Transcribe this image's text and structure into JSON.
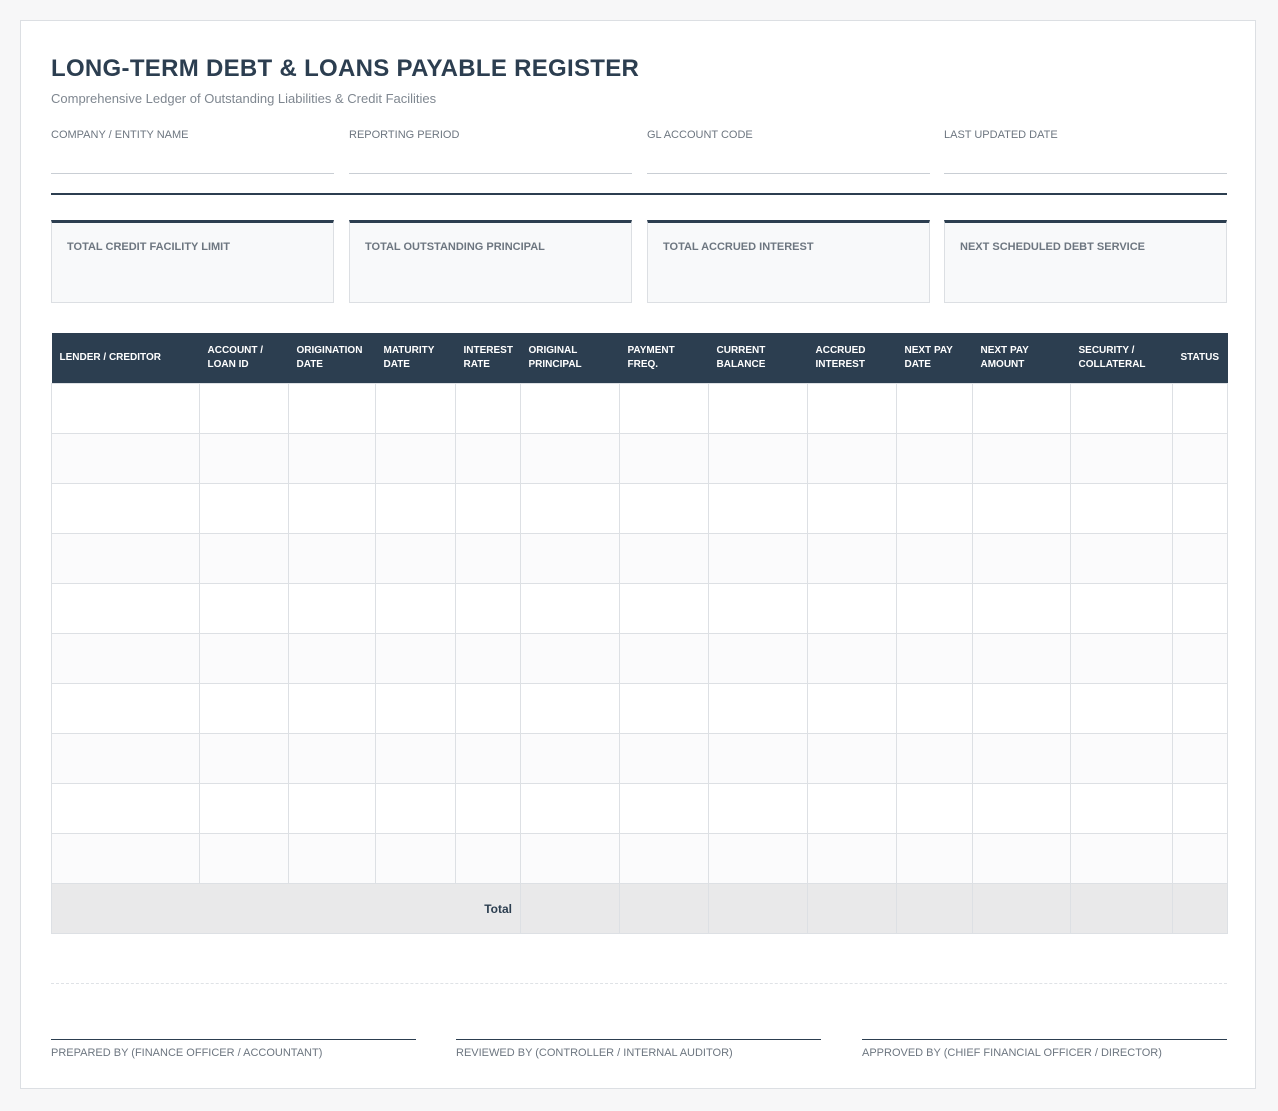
{
  "header": {
    "title": "LONG-TERM DEBT & LOANS PAYABLE REGISTER",
    "subtitle": "Comprehensive Ledger of Outstanding Liabilities & Credit Facilities"
  },
  "meta_fields": [
    {
      "label": "COMPANY / ENTITY NAME",
      "value": ""
    },
    {
      "label": "REPORTING PERIOD",
      "value": ""
    },
    {
      "label": "GL ACCOUNT CODE",
      "value": ""
    },
    {
      "label": "LAST UPDATED DATE",
      "value": ""
    }
  ],
  "summary_cards": [
    {
      "label": "TOTAL CREDIT FACILITY LIMIT",
      "value": ""
    },
    {
      "label": "TOTAL OUTSTANDING PRINCIPAL",
      "value": ""
    },
    {
      "label": "TOTAL ACCRUED INTEREST",
      "value": ""
    },
    {
      "label": "NEXT SCHEDULED DEBT SERVICE",
      "value": ""
    }
  ],
  "table": {
    "columns": [
      [
        "LENDER / CREDITOR"
      ],
      [
        "ACCOUNT /",
        "LOAN ID"
      ],
      [
        "ORIGINATION",
        "DATE"
      ],
      [
        "MATURITY",
        "DATE"
      ],
      [
        "INTEREST",
        "RATE"
      ],
      [
        "ORIGINAL",
        "PRINCIPAL"
      ],
      [
        "PAYMENT",
        "FREQ."
      ],
      [
        "CURRENT",
        "BALANCE"
      ],
      [
        "ACCRUED",
        "INTEREST"
      ],
      [
        "NEXT PAY",
        "DATE"
      ],
      [
        "NEXT PAY",
        "AMOUNT"
      ],
      [
        "SECURITY /",
        "COLLATERAL"
      ],
      [
        "STATUS"
      ]
    ],
    "rows": [
      [
        "",
        "",
        "",
        "",
        "",
        "",
        "",
        "",
        "",
        "",
        "",
        "",
        ""
      ],
      [
        "",
        "",
        "",
        "",
        "",
        "",
        "",
        "",
        "",
        "",
        "",
        "",
        ""
      ],
      [
        "",
        "",
        "",
        "",
        "",
        "",
        "",
        "",
        "",
        "",
        "",
        "",
        ""
      ],
      [
        "",
        "",
        "",
        "",
        "",
        "",
        "",
        "",
        "",
        "",
        "",
        "",
        ""
      ],
      [
        "",
        "",
        "",
        "",
        "",
        "",
        "",
        "",
        "",
        "",
        "",
        "",
        ""
      ],
      [
        "",
        "",
        "",
        "",
        "",
        "",
        "",
        "",
        "",
        "",
        "",
        "",
        ""
      ],
      [
        "",
        "",
        "",
        "",
        "",
        "",
        "",
        "",
        "",
        "",
        "",
        "",
        ""
      ],
      [
        "",
        "",
        "",
        "",
        "",
        "",
        "",
        "",
        "",
        "",
        "",
        "",
        ""
      ],
      [
        "",
        "",
        "",
        "",
        "",
        "",
        "",
        "",
        "",
        "",
        "",
        "",
        ""
      ],
      [
        "",
        "",
        "",
        "",
        "",
        "",
        "",
        "",
        "",
        "",
        "",
        "",
        ""
      ]
    ],
    "total_label": "Total"
  },
  "signatures": [
    {
      "label": "PREPARED BY (FINANCE OFFICER / ACCOUNTANT)"
    },
    {
      "label": "REVIEWED BY (CONTROLLER / INTERNAL AUDITOR)"
    },
    {
      "label": "APPROVED BY (CHIEF FINANCIAL OFFICER / DIRECTOR)"
    }
  ],
  "colors": {
    "header_bg": "#2c3e50",
    "total_bg": "#e9e9ea",
    "card_bg": "#f8f9fa"
  }
}
